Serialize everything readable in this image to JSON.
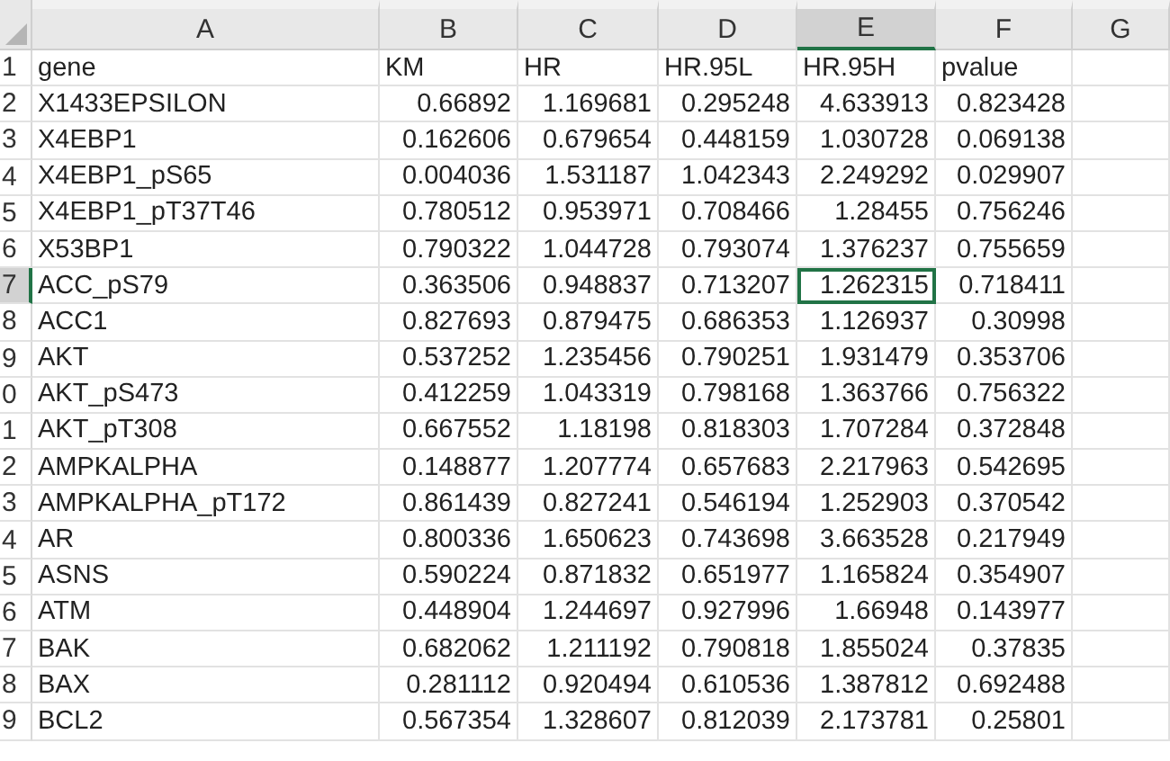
{
  "columns": [
    {
      "label": "A",
      "selected": false
    },
    {
      "label": "B",
      "selected": false
    },
    {
      "label": "C",
      "selected": false
    },
    {
      "label": "D",
      "selected": false
    },
    {
      "label": "E",
      "selected": true
    },
    {
      "label": "F",
      "selected": false
    },
    {
      "label": "G",
      "selected": false
    }
  ],
  "rows": [
    {
      "number": "1",
      "selected": false,
      "cells": [
        "gene",
        "KM",
        "HR",
        "HR.95L",
        "HR.95H",
        "pvalue"
      ]
    },
    {
      "number": "2",
      "selected": false,
      "cells": [
        "X1433EPSILON",
        "0.66892",
        "1.169681",
        "0.295248",
        "4.633913",
        "0.823428"
      ]
    },
    {
      "number": "3",
      "selected": false,
      "cells": [
        "X4EBP1",
        "0.162606",
        "0.679654",
        "0.448159",
        "1.030728",
        "0.069138"
      ]
    },
    {
      "number": "4",
      "selected": false,
      "cells": [
        "X4EBP1_pS65",
        "0.004036",
        "1.531187",
        "1.042343",
        "2.249292",
        "0.029907"
      ]
    },
    {
      "number": "5",
      "selected": false,
      "cells": [
        "X4EBP1_pT37T46",
        "0.780512",
        "0.953971",
        "0.708466",
        "1.28455",
        "0.756246"
      ]
    },
    {
      "number": "6",
      "selected": false,
      "cells": [
        "X53BP1",
        "0.790322",
        "1.044728",
        "0.793074",
        "1.376237",
        "0.755659"
      ]
    },
    {
      "number": "7",
      "selected": true,
      "cells": [
        "ACC_pS79",
        "0.363506",
        "0.948837",
        "0.713207",
        "1.262315",
        "0.718411"
      ]
    },
    {
      "number": "8",
      "selected": false,
      "cells": [
        "ACC1",
        "0.827693",
        "0.879475",
        "0.686353",
        "1.126937",
        "0.30998"
      ]
    },
    {
      "number": "9",
      "selected": false,
      "cells": [
        "AKT",
        "0.537252",
        "1.235456",
        "0.790251",
        "1.931479",
        "0.353706"
      ]
    },
    {
      "number": "0",
      "selected": false,
      "cells": [
        "AKT_pS473",
        "0.412259",
        "1.043319",
        "0.798168",
        "1.363766",
        "0.756322"
      ]
    },
    {
      "number": "1",
      "selected": false,
      "cells": [
        "AKT_pT308",
        "0.667552",
        "1.18198",
        "0.818303",
        "1.707284",
        "0.372848"
      ]
    },
    {
      "number": "2",
      "selected": false,
      "cells": [
        "AMPKALPHA",
        "0.148877",
        "1.207774",
        "0.657683",
        "2.217963",
        "0.542695"
      ]
    },
    {
      "number": "3",
      "selected": false,
      "cells": [
        "AMPKALPHA_pT172",
        "0.861439",
        "0.827241",
        "0.546194",
        "1.252903",
        "0.370542"
      ]
    },
    {
      "number": "4",
      "selected": false,
      "cells": [
        "AR",
        "0.800336",
        "1.650623",
        "0.743698",
        "3.663528",
        "0.217949"
      ]
    },
    {
      "number": "5",
      "selected": false,
      "cells": [
        "ASNS",
        "0.590224",
        "0.871832",
        "0.651977",
        "1.165824",
        "0.354907"
      ]
    },
    {
      "number": "6",
      "selected": false,
      "cells": [
        "ATM",
        "0.448904",
        "1.244697",
        "0.927996",
        "1.66948",
        "0.143977"
      ]
    },
    {
      "number": "7",
      "selected": false,
      "cells": [
        "BAK",
        "0.682062",
        "1.211192",
        "0.790818",
        "1.855024",
        "0.37835"
      ]
    },
    {
      "number": "8",
      "selected": false,
      "cells": [
        "BAX",
        "0.281112",
        "0.920494",
        "0.610536",
        "1.387812",
        "0.692488"
      ]
    },
    {
      "number": "9",
      "selected": false,
      "cells": [
        "BCL2",
        "0.567354",
        "1.328607",
        "0.812039",
        "2.173781",
        "0.25801"
      ]
    }
  ]
}
